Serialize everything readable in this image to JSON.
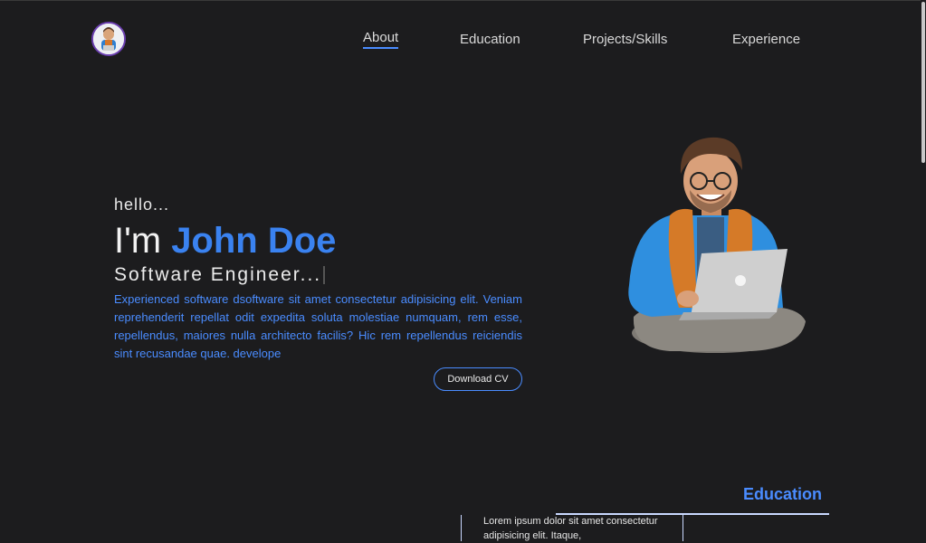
{
  "nav": {
    "items": [
      {
        "label": "About",
        "active": true
      },
      {
        "label": "Education",
        "active": false
      },
      {
        "label": "Projects/Skills",
        "active": false
      },
      {
        "label": "Experience",
        "active": false
      }
    ]
  },
  "hero": {
    "greeting": "hello...",
    "name_prefix": "I'm ",
    "name": "John Doe",
    "role": "Software Engineer...",
    "bio": "Experienced software dsoftware sit amet consectetur adipisicing elit. Veniam reprehenderit repellat odit expedita soluta molestiae numquam, rem esse, repellendus, maiores nulla architecto facilis? Hic rem repellendus reiciendis sint recusandae quae. develope",
    "cv_button": "Download CV"
  },
  "education": {
    "title": "Education",
    "first_item_text": "Lorem ipsum dolor sit amet consectetur adipisicing elit. Itaque,"
  },
  "colors": {
    "background": "#1c1c1e",
    "accent": "#3a82f0",
    "text": "#e6e6e6"
  }
}
